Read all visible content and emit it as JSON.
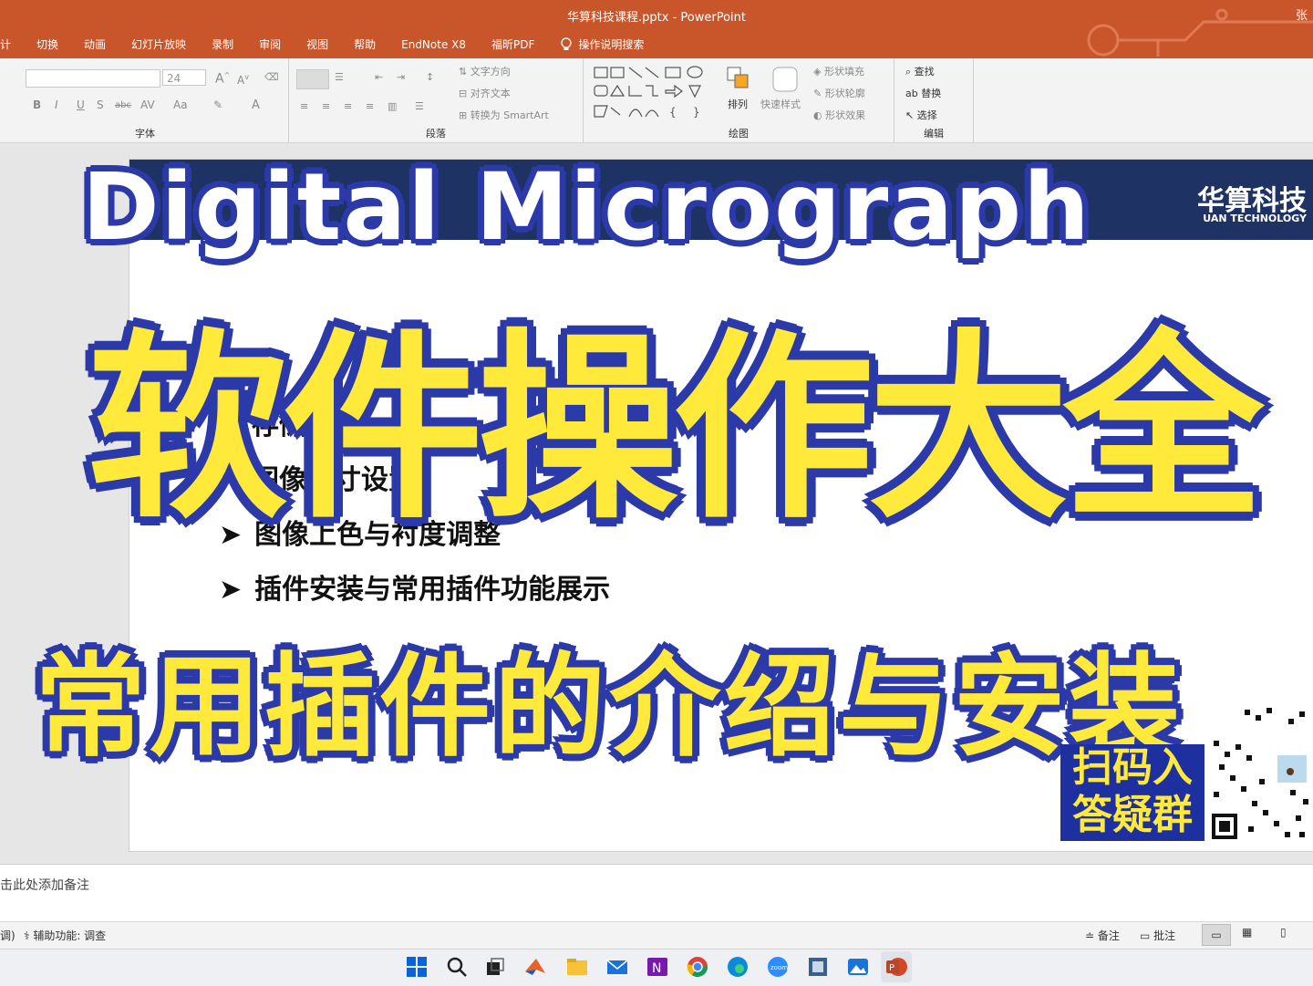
{
  "window": {
    "title": "华算科技课程.pptx  -  PowerPoint",
    "user": "张"
  },
  "menu": [
    "计",
    "切换",
    "动画",
    "幻灯片放映",
    "录制",
    "审阅",
    "视图",
    "帮助",
    "EndNote X8",
    "福昕PDF",
    "操作说明搜索"
  ],
  "ribbon": {
    "font_size": "24",
    "groups": {
      "font": "字体",
      "paragraph": "段落",
      "drawing": "绘图",
      "editing": "编辑"
    },
    "paragraph_buttons": {
      "text_direction": "文字方向",
      "align_text": "对齐文本",
      "smartart": "转换为 SmartArt"
    },
    "drawing_buttons": {
      "arrange": "排列",
      "quick_styles": "快速样式",
      "shape_fill": "形状填充",
      "shape_outline": "形状轮廓",
      "shape_effects": "形状效果"
    },
    "editing_buttons": {
      "find": "查找",
      "replace": "替换",
      "select": "选择"
    }
  },
  "slide": {
    "logo_cn": "华算科技",
    "logo_en": "UAN TECHNOLOGY",
    "bullets": [
      "存储",
      "图像尺寸设置",
      "图像上色与衬度调整",
      "插件安装与常用插件功能展示"
    ]
  },
  "overlay": {
    "title_en": "Digital  Micrograph",
    "title_cn": "软件操作大全",
    "subtitle": "常用插件的介绍与安装",
    "qr_label_line1": "扫码入",
    "qr_label_line2": "答疑群"
  },
  "notes": {
    "placeholder": "击此处添加备注"
  },
  "status": {
    "left": "调)",
    "accessibility": "辅助功能: 调查",
    "notes_btn": "备注",
    "comments_btn": "批注"
  },
  "colors": {
    "titlebar": "#c9552a",
    "slide_header": "#1e3263",
    "overlay_yellow": "#ffe93a",
    "overlay_outline": "#2b3aa8"
  }
}
